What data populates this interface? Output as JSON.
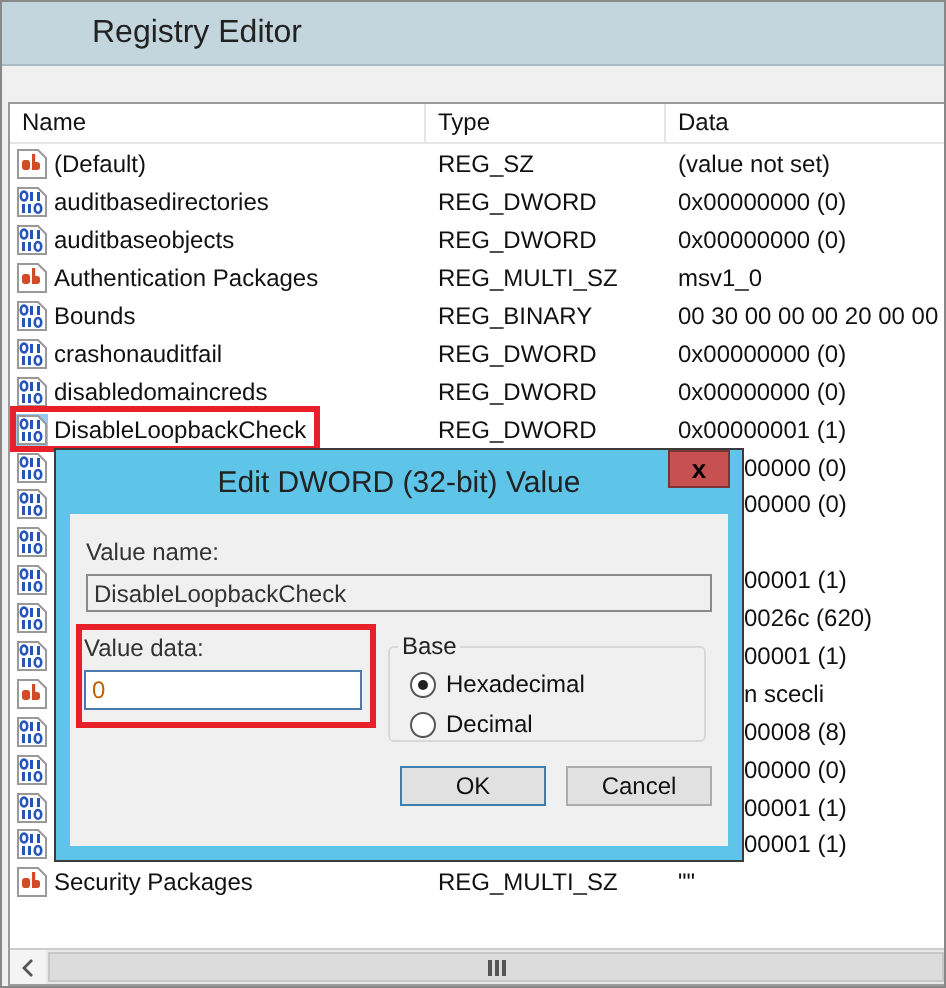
{
  "window": {
    "title": "Registry Editor"
  },
  "table": {
    "columns": [
      "Name",
      "Type",
      "Data"
    ],
    "rows": [
      {
        "kind": "string",
        "name": "(Default)",
        "type": "REG_SZ",
        "data": "(value not set)",
        "selected": false
      },
      {
        "kind": "binary",
        "name": "auditbasedirectories",
        "type": "REG_DWORD",
        "data": "0x00000000 (0)",
        "selected": false
      },
      {
        "kind": "binary",
        "name": "auditbaseobjects",
        "type": "REG_DWORD",
        "data": "0x00000000 (0)",
        "selected": false
      },
      {
        "kind": "string",
        "name": "Authentication Packages",
        "type": "REG_MULTI_SZ",
        "data": "msv1_0",
        "selected": false
      },
      {
        "kind": "binary",
        "name": "Bounds",
        "type": "REG_BINARY",
        "data": "00 30 00 00 00 20 00 00",
        "selected": false
      },
      {
        "kind": "binary",
        "name": "crashonauditfail",
        "type": "REG_DWORD",
        "data": "0x00000000 (0)",
        "selected": false
      },
      {
        "kind": "binary",
        "name": "disabledomaincreds",
        "type": "REG_DWORD",
        "data": "0x00000000 (0)",
        "selected": false
      },
      {
        "kind": "binary",
        "name": "DisableLoopbackCheck",
        "type": "REG_DWORD",
        "data": "0x00000001 (1)",
        "selected": true,
        "highlighted": true
      },
      {
        "kind": "binary",
        "data": "00000 (0)",
        "selected": false
      },
      {
        "kind": "binary",
        "data": "00000 (0)",
        "selected": false
      },
      {
        "kind": "binary",
        "selected": false
      },
      {
        "kind": "binary",
        "data": "00001 (1)",
        "selected": false
      },
      {
        "kind": "binary",
        "data": "0026c (620)",
        "selected": false
      },
      {
        "kind": "binary",
        "data": "00001 (1)",
        "selected": false
      },
      {
        "kind": "string",
        "data": "n scecli",
        "selected": false
      },
      {
        "kind": "binary",
        "data": "00008 (8)",
        "selected": false
      },
      {
        "kind": "binary",
        "data": "00000 (0)",
        "selected": false
      },
      {
        "kind": "binary",
        "data": "00001 (1)",
        "selected": false
      },
      {
        "kind": "binary",
        "data": "00001 (1)",
        "selected": false
      },
      {
        "kind": "string",
        "name": "Security Packages",
        "type": "REG_MULTI_SZ",
        "data": "\"\"",
        "selected": false
      }
    ]
  },
  "dialog": {
    "title": "Edit DWORD (32-bit) Value",
    "close": "x",
    "value_name_label": "Value name:",
    "value_name": "DisableLoopbackCheck",
    "value_data_label": "Value data:",
    "value_data": "0",
    "value_data_highlighted": true,
    "base_label": "Base",
    "base_options": [
      {
        "label": "Hexadecimal",
        "selected": true
      },
      {
        "label": "Decimal",
        "selected": false
      }
    ],
    "buttons": [
      "OK",
      "Cancel"
    ]
  }
}
